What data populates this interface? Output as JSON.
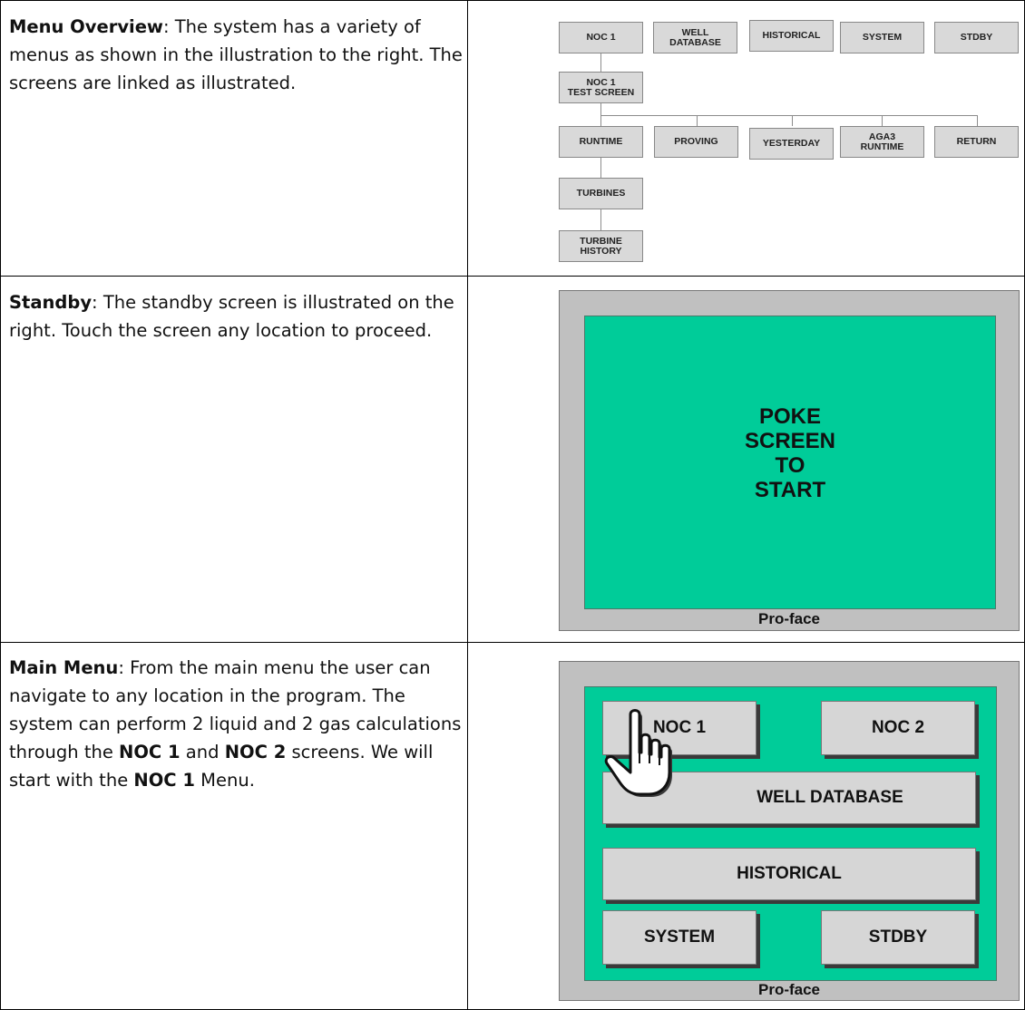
{
  "rows": [
    {
      "heading": "Menu Overview",
      "text": ":  The system has a variety of menus as shown in the illustration to the right.  The screens are linked as illustrated."
    },
    {
      "heading": "Standby",
      "text": ":  The standby screen is illustrated on the right.  Touch the screen any location to proceed."
    },
    {
      "heading": "Main Menu",
      "text_1": ":  From the main menu the user can navigate to any location in the program. The system can perform 2 liquid and 2 gas calculations through the ",
      "bold_1": "NOC 1",
      "text_2": " and ",
      "bold_2": "NOC 2",
      "text_3": " screens.  We will start with the ",
      "bold_3": "NOC 1",
      "text_4": " Menu."
    }
  ],
  "menu_diagram": {
    "top_row": [
      "NOC 1",
      "WELL\nDATABASE",
      "HISTORICAL",
      "SYSTEM",
      "STDBY"
    ],
    "test_screen": "NOC 1\nTEST SCREEN",
    "second_row": [
      "RUNTIME",
      "PROVING",
      "YESTERDAY",
      "AGA3\nRUNTIME",
      "RETURN"
    ],
    "turbines": "TURBINES",
    "turbine_history": "TURBINE\nHISTORY"
  },
  "standby_screen": {
    "message": "POKE\nSCREEN\nTO\nSTART",
    "brand": "Pro-face",
    "screen_color": "#00cc99"
  },
  "main_menu_screen": {
    "buttons": {
      "noc1": "NOC 1",
      "noc2": "NOC 2",
      "well_database": "WELL DATABASE",
      "historical": "HISTORICAL",
      "system": "SYSTEM",
      "stdby": "STDBY"
    },
    "brand": "Pro-face",
    "pointer_icon": "hand-pointer-icon"
  }
}
